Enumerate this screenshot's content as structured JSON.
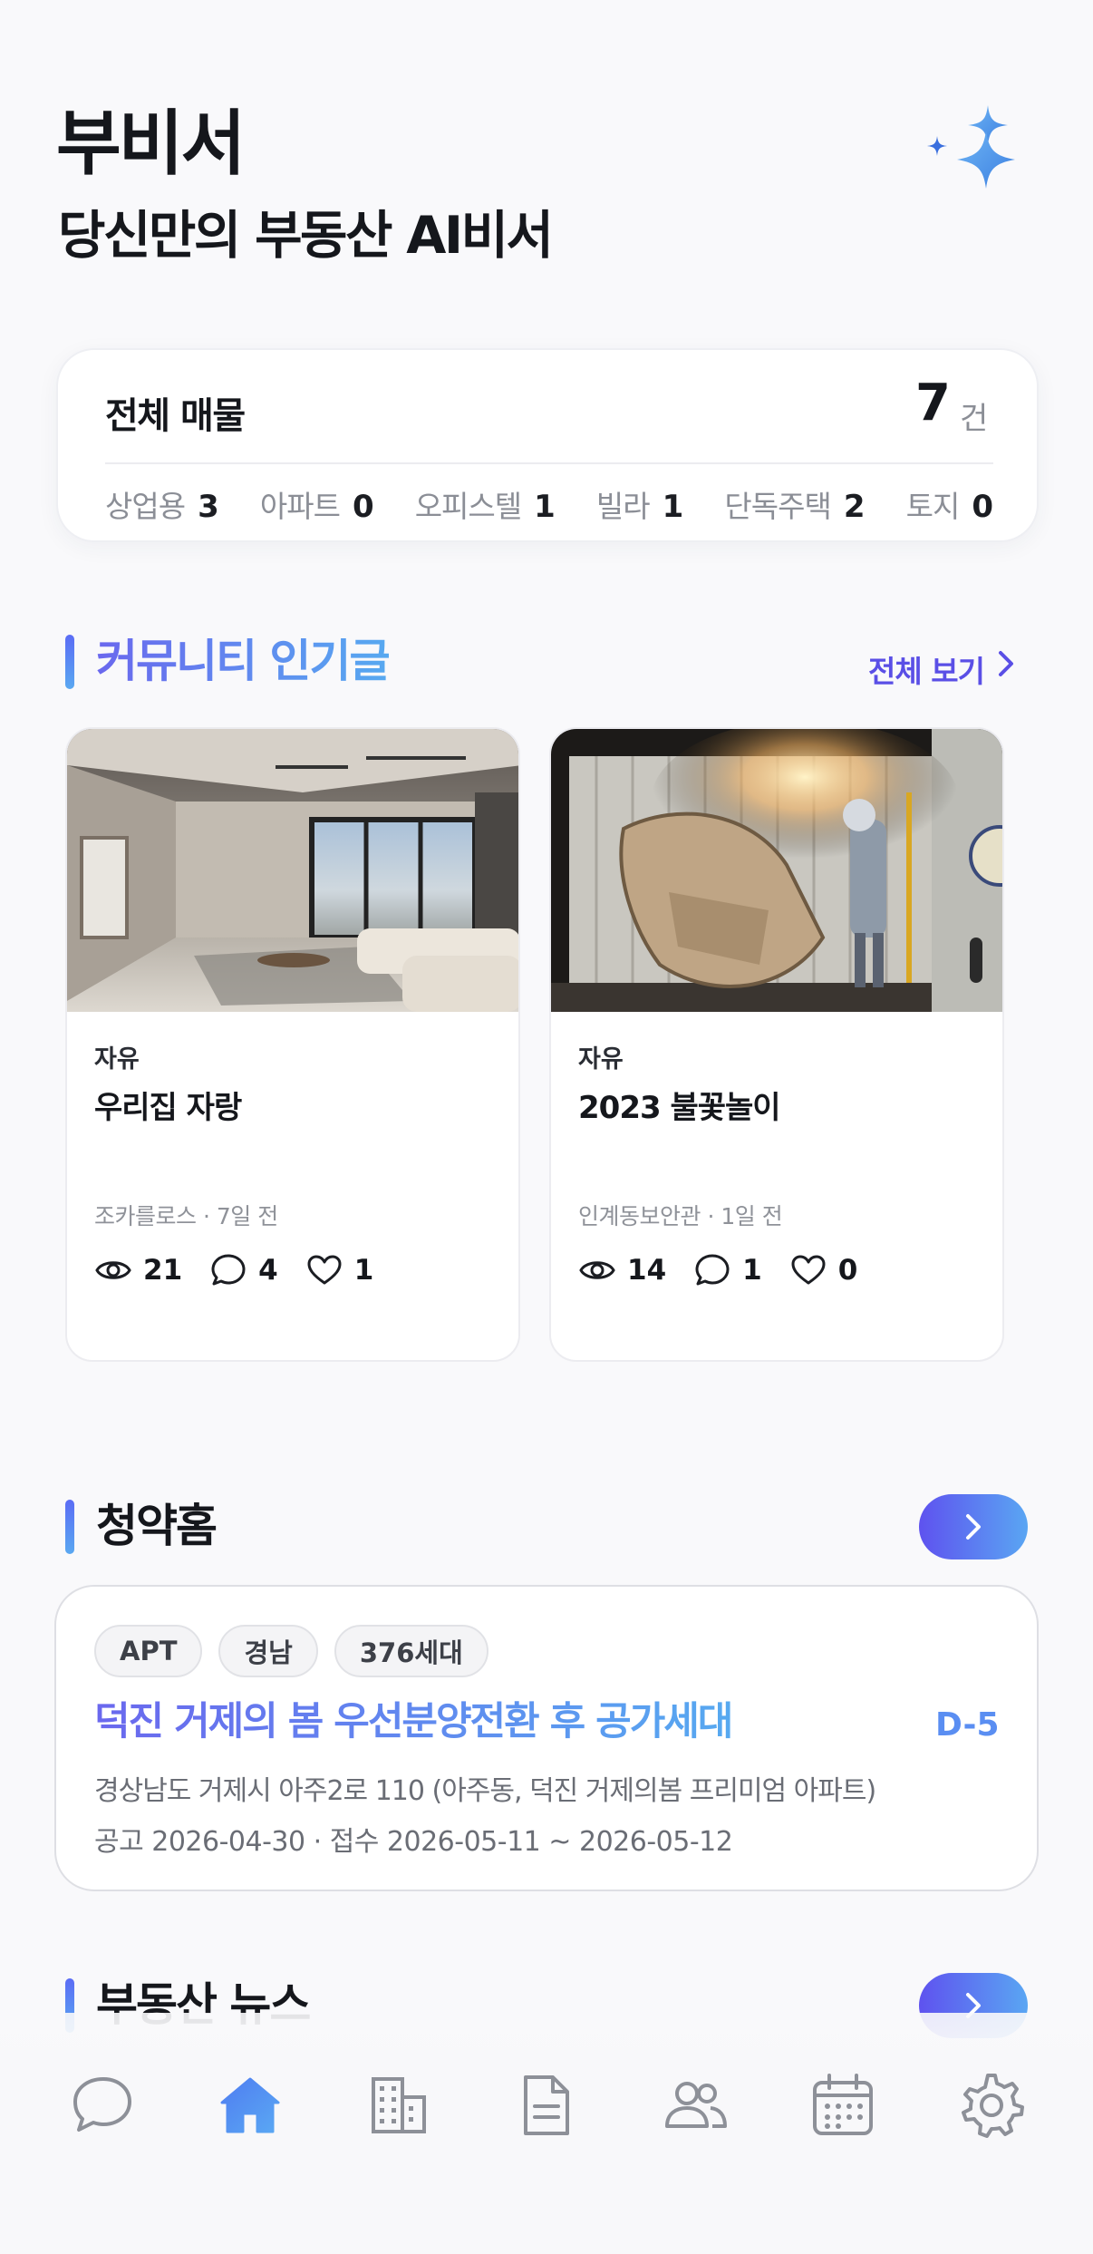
{
  "header": {
    "title": "부비서",
    "subtitle": "당신만의 부동산 AI비서",
    "logo_icon": "sparkle-stars-icon"
  },
  "totals": {
    "label": "전체 매물",
    "count": "7",
    "unit": "건",
    "categories": [
      {
        "name": "상업용",
        "count": "3"
      },
      {
        "name": "아파트",
        "count": "0"
      },
      {
        "name": "오피스텔",
        "count": "1"
      },
      {
        "name": "빌라",
        "count": "1"
      },
      {
        "name": "단독주택",
        "count": "2"
      },
      {
        "name": "토지",
        "count": "0"
      }
    ]
  },
  "community": {
    "title": "커뮤니티 인기글",
    "view_all": "전체 보기",
    "posts": [
      {
        "category": "자유",
        "title": "우리집 자랑",
        "meta": "조카를로스 · 7일 전",
        "views": "21",
        "comments": "4",
        "likes": "1",
        "image": "living-room-photo"
      },
      {
        "category": "자유",
        "title": "2023 불꽃놀이",
        "meta": "인계동보안관 · 1일 전",
        "views": "14",
        "comments": "1",
        "likes": "0",
        "image": "welding-sparks-photo"
      }
    ]
  },
  "subscription": {
    "title": "청약홈",
    "tags": [
      "APT",
      "경남",
      "376세대"
    ],
    "item_title": "덕진 거제의 봄 우선분양전환 후 공가세대",
    "dday": "D-5",
    "address": "경상남도 거제시 아주2로 110 (아주동, 덕진 거제의봄 프리미엄 아파트)",
    "dates": "공고 2026-04-30 · 접수 2026-05-11 ~ 2026-05-12"
  },
  "news": {
    "title": "부동산 뉴스"
  },
  "nav": {
    "items": [
      "chat-icon",
      "home-icon",
      "building-icon",
      "document-icon",
      "users-icon",
      "calendar-icon",
      "gear-icon"
    ],
    "active": "home-icon"
  },
  "colors": {
    "accent": "#5a4fe6",
    "gradient_start": "#5e52ef",
    "gradient_end": "#5aa6f3",
    "dday": "#5a8ef2"
  }
}
